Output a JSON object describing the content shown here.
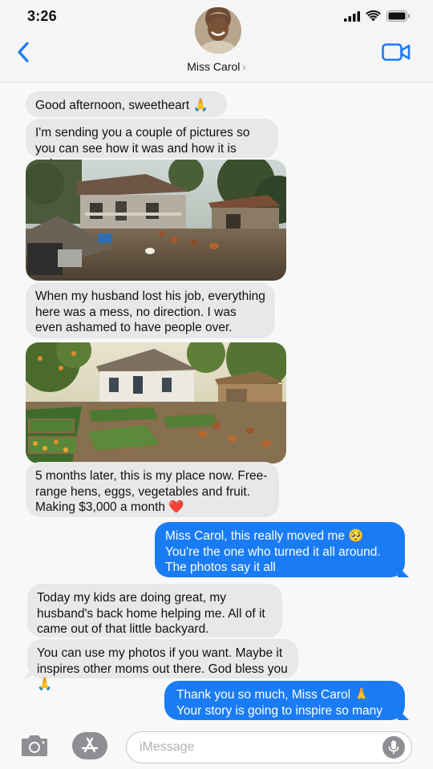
{
  "status": {
    "time": "3:26"
  },
  "header": {
    "contact_name": "Miss Carol",
    "chevron": "›"
  },
  "messages": [
    {
      "dir": "in",
      "type": "text",
      "text": "Good afternoon, sweetheart 🙏"
    },
    {
      "dir": "in",
      "type": "text",
      "text": "I'm sending you a couple of pictures so you can see how it was and how it is today"
    },
    {
      "dir": "in",
      "type": "image",
      "description": "messy-backyard-before"
    },
    {
      "dir": "in",
      "type": "text",
      "text": "When my husband lost his job, everything here was a mess, no direction. I was even ashamed to have people over."
    },
    {
      "dir": "in",
      "type": "image",
      "description": "garden-backyard-after"
    },
    {
      "dir": "in",
      "type": "text",
      "text": "5 months later, this is my place now. Free-range hens, eggs, vegetables and fruit. Making $3,000 a month ❤️"
    },
    {
      "dir": "out",
      "type": "text",
      "text": "Miss Carol, this really moved me 🥺 You're the one who turned it all around. The photos say it all"
    },
    {
      "dir": "in",
      "type": "text",
      "text": "Today my kids are doing great, my husband's back home helping me. All of it came out of that little backyard."
    },
    {
      "dir": "in",
      "type": "text",
      "text": "You can use my photos if you want. Maybe it inspires other moms out there. God bless you 🙏"
    },
    {
      "dir": "out",
      "type": "text",
      "text": "Thank you so much, Miss Carol 🙏 Your story is going to inspire so many women"
    }
  ],
  "input": {
    "placeholder": "iMessage"
  },
  "icons": [
    "signal-icon",
    "wifi-icon",
    "battery-icon",
    "back-chevron-icon",
    "video-camera-icon",
    "camera-icon",
    "app-store-icon",
    "microphone-icon"
  ],
  "colors": {
    "accent": "#1a7cf5",
    "incoming_bubble": "#e8e8eb",
    "outgoing_bubble": "#1a7cf5"
  }
}
